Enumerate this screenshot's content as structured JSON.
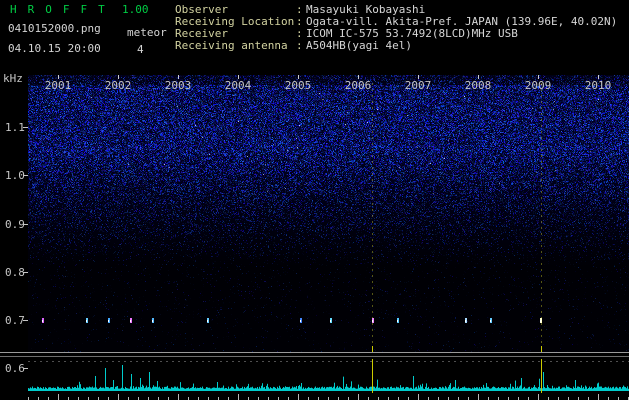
{
  "app": {
    "title": "HROFFT",
    "version": "1.00",
    "filename": "0410152000.png",
    "mode": "meteor",
    "datetime": "04.10.15 20:00",
    "echo_count": "4"
  },
  "info": {
    "separator": ":",
    "rows": [
      {
        "label": "Observer",
        "value": "Masayuki Kobayashi"
      },
      {
        "label": "Receiving Location",
        "value": "Ogata-vill. Akita-Pref. JAPAN (139.96E, 40.02N)"
      },
      {
        "label": "Receiver",
        "value": "ICOM IC-575 53.7492(8LCD)MHz USB"
      },
      {
        "label": "Receiving antenna",
        "value": "A504HB(yagi 4el)"
      }
    ]
  },
  "chart_data": {
    "type": "heatmap",
    "title": "HRO meteor echo spectrogram 2004-10-15 20:00-20:10",
    "x_tick_labels": [
      "2001",
      "2002",
      "2003",
      "2004",
      "2005",
      "2006",
      "2007",
      "2008",
      "2009",
      "2010"
    ],
    "x_unit": "time hhmm",
    "y_unit_label": "kHz",
    "y_tick_labels": [
      "1.1",
      "1.0",
      "0.9",
      "0.8",
      "0.7",
      "0.6"
    ],
    "y_range_khz": [
      0.62,
      1.25
    ],
    "echo_row_khz": 0.7,
    "marker_color": "#cccc00",
    "meteor_echoes": [
      {
        "t": 0.73,
        "color": "#dd66ff"
      },
      {
        "t": 1.47,
        "color": "#66ccff"
      },
      {
        "t": 1.83,
        "color": "#44aaff"
      },
      {
        "t": 2.2,
        "color": "#ee77ff"
      },
      {
        "t": 2.57,
        "color": "#55bbff"
      },
      {
        "t": 3.48,
        "color": "#66ccff"
      },
      {
        "t": 5.03,
        "color": "#4488ff"
      },
      {
        "t": 5.53,
        "color": "#66ddff"
      },
      {
        "t": 6.23,
        "color": "#ee88ff"
      },
      {
        "t": 6.65,
        "color": "#55ccff"
      },
      {
        "t": 7.78,
        "color": "#aaddff"
      },
      {
        "t": 8.2,
        "color": "#66ccff"
      },
      {
        "t": 9.03,
        "color": "#ffffcc"
      }
    ],
    "event_markers_t": [
      6.23,
      9.05
    ],
    "level_plot": {
      "trace_color": "#00cccc",
      "spikes": [
        {
          "t": 1.62,
          "h": 14
        },
        {
          "t": 1.78,
          "h": 22
        },
        {
          "t": 1.92,
          "h": 10
        },
        {
          "t": 2.07,
          "h": 25
        },
        {
          "t": 2.22,
          "h": 16
        },
        {
          "t": 2.37,
          "h": 12
        },
        {
          "t": 2.52,
          "h": 18
        },
        {
          "t": 2.65,
          "h": 9
        },
        {
          "t": 3.65,
          "h": 8
        },
        {
          "t": 5.05,
          "h": 7
        },
        {
          "t": 6.23,
          "h": 12
        },
        {
          "t": 6.92,
          "h": 14
        },
        {
          "t": 7.62,
          "h": 10
        },
        {
          "t": 8.72,
          "h": 12
        },
        {
          "t": 9.08,
          "h": 18
        },
        {
          "t": 9.62,
          "h": 10
        }
      ]
    }
  }
}
